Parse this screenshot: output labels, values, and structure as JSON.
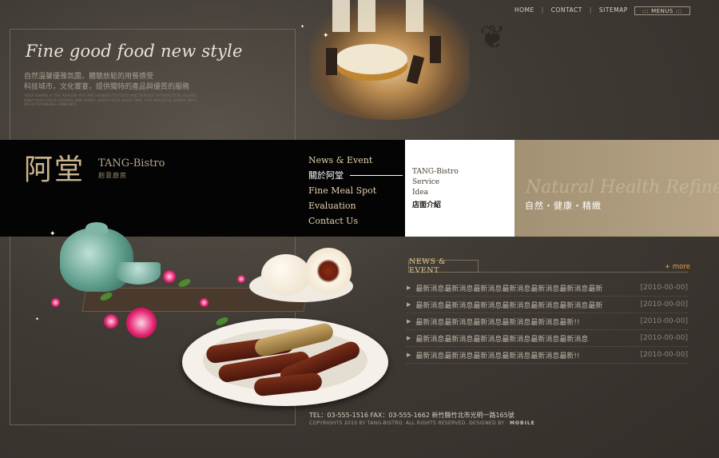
{
  "top_nav": {
    "home": "HOME",
    "contact": "CONTACT",
    "sitemap": "SITEMAP",
    "menus": "::: MENUS :::"
  },
  "hero": {
    "tagline": "Fine good food new style",
    "intro_line1": "自然溫馨優雅氛圍，體驗放鬆的用餐感受",
    "intro_line2": "科技城市，文化饗宴，提供獨特的產品與優質的服務",
    "intro_small": "YOUR DINING IS THE REASON YOU ARE HANDED TO FOOD AND SERVICE SATISFACTION. PLEASE ENJOY WITH YOUR FRIENDS AND FAMILY. GOOD FOOD GOOD TIME. FOR GRACEFUL DINING WITH AN OUTSTANDING AMBIANCE."
  },
  "logo": {
    "glyph": "阿堂",
    "name": "TANG-Bistro",
    "sub": "創意廚房"
  },
  "main_nav": {
    "items": [
      "News & Event",
      "關於阿堂",
      "Fine Meal Spot",
      "Evaluation",
      "Contact Us"
    ],
    "active_index": 1
  },
  "submenu": {
    "items": [
      "TANG-Bistro",
      "Service",
      "Idea",
      "店面介紹"
    ],
    "selected_index": 3
  },
  "banner": {
    "script": "Natural Health Refined",
    "chinese": "自然・健康・精緻"
  },
  "news": {
    "title": "NEWS & EVENT",
    "more": "+ more",
    "items": [
      {
        "text": "最新消息最新消息最新消息最新消息最新消息最新消息最新",
        "date": "[2010-00-00]"
      },
      {
        "text": "最新消息最新消息最新消息最新消息最新消息最新消息最新",
        "date": "[2010-00-00]"
      },
      {
        "text": "最新消息最新消息最新消息最新消息最新消息最新!!",
        "date": "[2010-00-00]"
      },
      {
        "text": "最新消息最新消息最新消息最新消息最新消息最新消息",
        "date": "[2010-00-00]"
      },
      {
        "text": "最新消息最新消息最新消息最新消息最新消息最新!!",
        "date": "[2010-00-00]"
      }
    ]
  },
  "footer": {
    "contact": "TEL：03-555-1516    FAX：03-555-1662    新竹縣竹北市光明一路165號",
    "copyright": "COPYRIGHTS 2010 BY TANG-BISTRO.    ALL RIGHTS RESERVED.    DESIGNED BY ·",
    "designer": "MOBILE"
  },
  "colors": {
    "band": "#050404",
    "banner": "#a39174",
    "accent": "#e8a14a",
    "gold": "#e3c98a"
  }
}
